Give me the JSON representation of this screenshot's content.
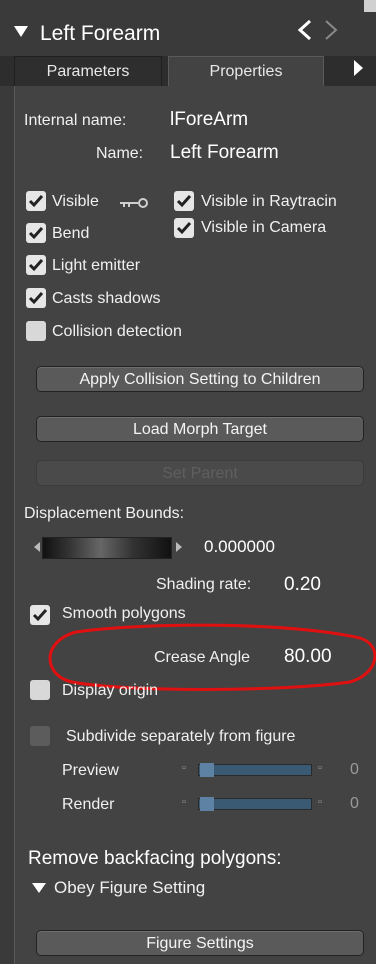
{
  "header": {
    "title": "Left Forearm",
    "prev_icon": "chevron-left-icon",
    "next_icon": "chevron-right-icon"
  },
  "tabs": [
    {
      "label": "Parameters",
      "active": false
    },
    {
      "label": "Properties",
      "active": true
    }
  ],
  "properties": {
    "internal_name_label": "Internal name:",
    "internal_name_value": "lForeArm",
    "name_label": "Name:",
    "name_value": "Left Forearm"
  },
  "checkboxes": {
    "visible": {
      "label": "Visible",
      "checked": true
    },
    "visible_raytracing": {
      "label": "Visible in Raytracin",
      "checked": true
    },
    "bend": {
      "label": "Bend",
      "checked": true
    },
    "visible_camera": {
      "label": "Visible in Camera",
      "checked": true
    },
    "light_emitter": {
      "label": "Light emitter",
      "checked": true
    },
    "casts_shadows": {
      "label": "Casts shadows",
      "checked": true
    },
    "collision_detection": {
      "label": "Collision detection",
      "checked": false
    },
    "smooth_polygons": {
      "label": "Smooth polygons",
      "checked": true
    },
    "display_origin": {
      "label": "Display origin",
      "checked": false
    },
    "subdivide_separately": {
      "label": "Subdivide separately from figure",
      "checked": false
    }
  },
  "buttons": {
    "apply_collision": "Apply Collision Setting to Children",
    "load_morph": "Load Morph Target",
    "set_parent": "Set Parent",
    "figure_settings": "Figure Settings"
  },
  "displacement": {
    "label": "Displacement Bounds:",
    "value": "0.000000"
  },
  "shading": {
    "label": "Shading rate:",
    "value": "0.20"
  },
  "crease": {
    "label": "Crease Angle",
    "value": "80.00"
  },
  "subdivision": {
    "preview_label": "Preview",
    "preview_value": "0",
    "render_label": "Render",
    "render_value": "0"
  },
  "backfacing": {
    "label": "Remove backfacing polygons:",
    "option": "Obey Figure Setting"
  },
  "annotation_color": "#e01010"
}
